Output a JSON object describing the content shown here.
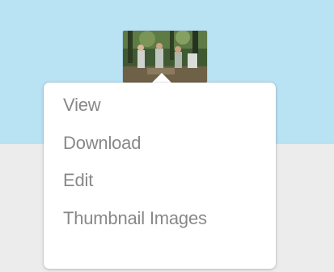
{
  "background": {
    "top_color": "#b9e2f3",
    "bottom_color": "#ececec"
  },
  "thumbnail": {
    "icon": "photo-thumbnail"
  },
  "context_menu": {
    "items": [
      {
        "label": "View"
      },
      {
        "label": "Download"
      },
      {
        "label": "Edit"
      },
      {
        "label": "Thumbnail Images"
      },
      {
        "label": ""
      }
    ],
    "text_color": "#888888"
  }
}
